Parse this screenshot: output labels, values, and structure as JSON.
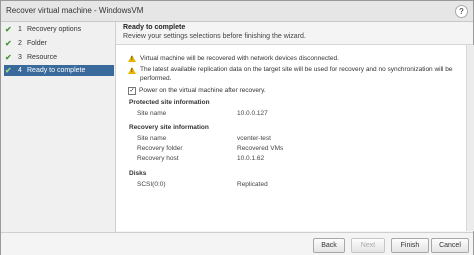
{
  "window": {
    "title": "Recover virtual machine - WindowsVM"
  },
  "sidebar": {
    "steps": [
      {
        "number": "1",
        "label": "Recovery options",
        "state": "completed"
      },
      {
        "number": "2",
        "label": "Folder",
        "state": "completed"
      },
      {
        "number": "3",
        "label": "Resource",
        "state": "completed"
      },
      {
        "number": "4",
        "label": "Ready to complete",
        "state": "active"
      }
    ]
  },
  "header": {
    "title": "Ready to complete",
    "subtitle": "Review your settings selections before finishing the wizard."
  },
  "warnings": {
    "network": "Virtual machine will be recovered with network devices disconnected.",
    "replication_line1": "The latest available replication data on the target site will be used for recovery and no synchronization will be",
    "replication_line2": "performed."
  },
  "power_on": {
    "label": "Power on the virtual machine after recovery.",
    "checked": true
  },
  "protected_site": {
    "heading": "Protected site information",
    "site_name_label": "Site name",
    "site_name_value": "10.0.0.127"
  },
  "recovery_site": {
    "heading": "Recovery site information",
    "site_name_label": "Site name",
    "site_name_value": "vcenter-test",
    "folder_label": "Recovery folder",
    "folder_value": "Recovered VMs",
    "host_label": "Recovery host",
    "host_value": "10.0.1.62"
  },
  "disks": {
    "heading": "Disks",
    "items": [
      {
        "name": "SCSI(0:0)",
        "status": "Replicated"
      }
    ]
  },
  "buttons": {
    "back": "Back",
    "next": "Next",
    "finish": "Finish",
    "cancel": "Cancel"
  },
  "colors": {
    "active_step": "#3a6a9b",
    "check": "#4a9a3a",
    "warning": "#e8b400"
  }
}
